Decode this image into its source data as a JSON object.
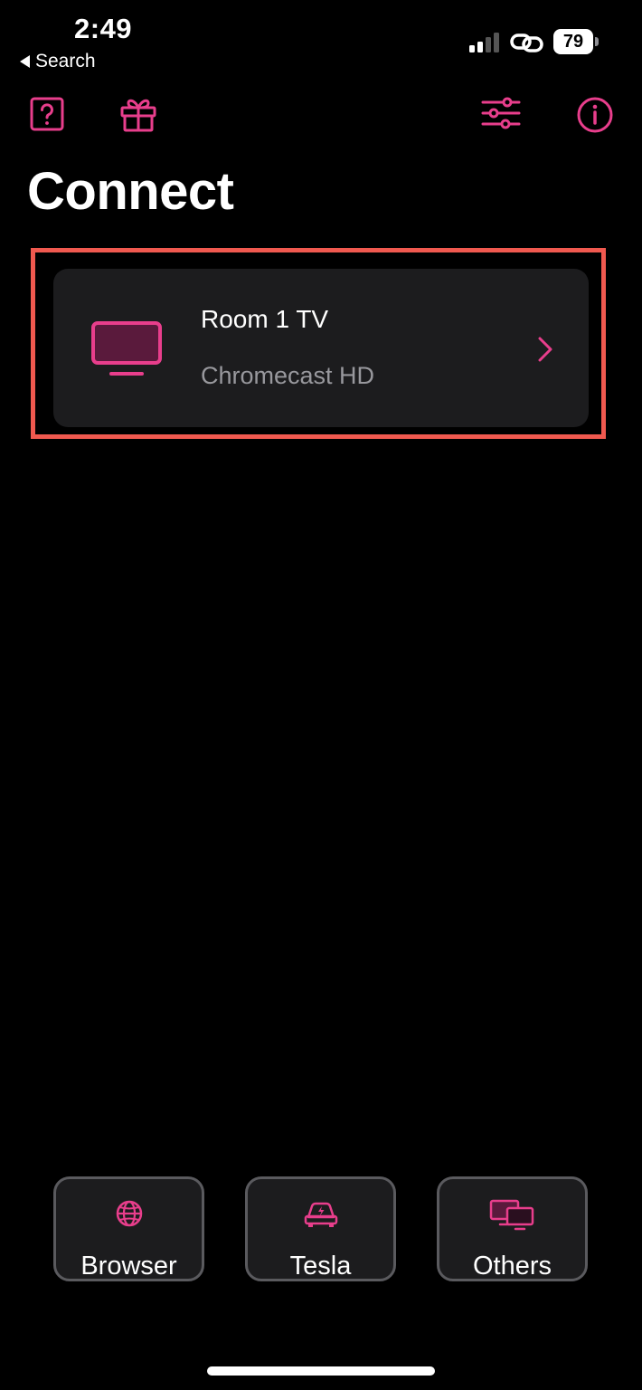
{
  "status_bar": {
    "time": "2:49",
    "back_label": "Search",
    "battery_level": "79"
  },
  "toolbar": {
    "help_icon": "question-square-icon",
    "gift_icon": "gift-icon",
    "settings_icon": "sliders-icon",
    "info_icon": "info-circle-icon"
  },
  "page": {
    "title": "Connect"
  },
  "devices": [
    {
      "name": "Room 1 TV",
      "type": "Chromecast HD",
      "icon": "tv-icon"
    }
  ],
  "bottom_buttons": [
    {
      "label": "Browser",
      "icon": "globe-icon"
    },
    {
      "label": "Tesla",
      "icon": "car-bolt-icon"
    },
    {
      "label": "Others",
      "icon": "monitors-icon"
    }
  ],
  "colors": {
    "accent": "#e83e8c",
    "highlight_border": "#f0594f",
    "card_background": "#1c1c1e",
    "secondary_text": "#98989d"
  }
}
